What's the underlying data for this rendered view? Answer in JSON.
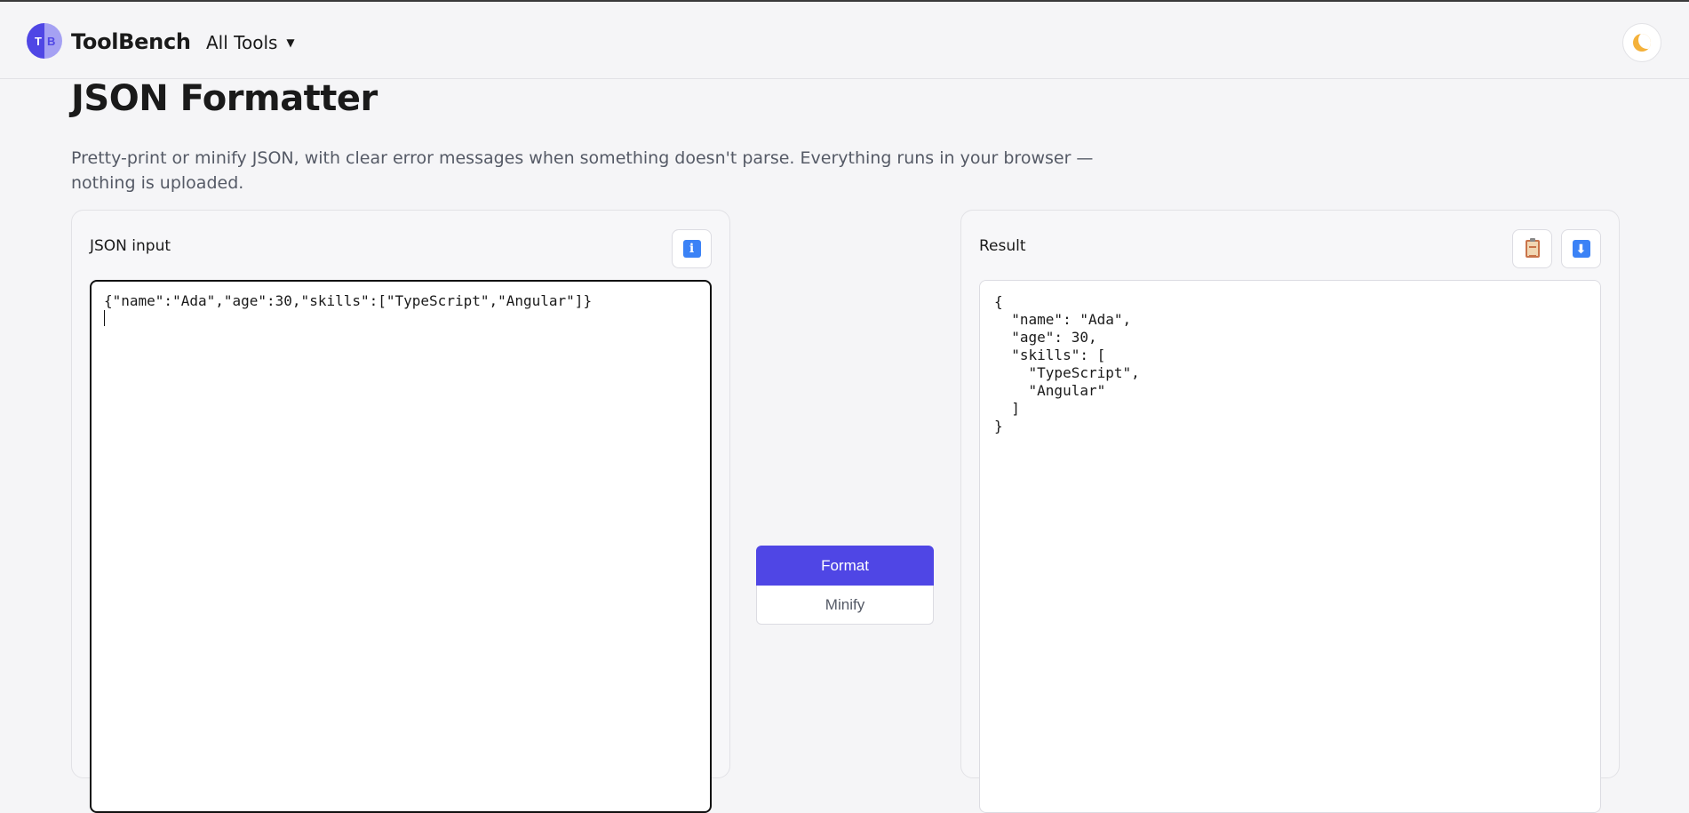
{
  "header": {
    "logo_left": "T",
    "logo_right": "B",
    "brand": "ToolBench",
    "nav_label": "All Tools",
    "nav_caret": "▼",
    "theme_toggle_icon": "moon-icon"
  },
  "page": {
    "title": "JSON Formatter",
    "description": "Pretty-print or minify JSON, with clear error messages when something doesn't parse. Everything runs in your browser — nothing is uploaded."
  },
  "input_panel": {
    "title": "JSON input",
    "info_icon": "info-icon",
    "info_glyph": "i",
    "value": "{\"name\":\"Ada\",\"age\":30,\"skills\":[\"TypeScript\",\"Angular\"]}"
  },
  "actions": {
    "format_label": "Format",
    "minify_label": "Minify"
  },
  "result_panel": {
    "title": "Result",
    "copy_icon": "clipboard-icon",
    "download_icon": "download-icon",
    "download_glyph": "⬇",
    "value": "{\n  \"name\": \"Ada\",\n  \"age\": 30,\n  \"skills\": [\n    \"TypeScript\",\n    \"Angular\"\n  ]\n}"
  },
  "colors": {
    "accent": "#4f46e5",
    "background": "#f5f5f7",
    "icon_blue": "#3b82f6"
  }
}
